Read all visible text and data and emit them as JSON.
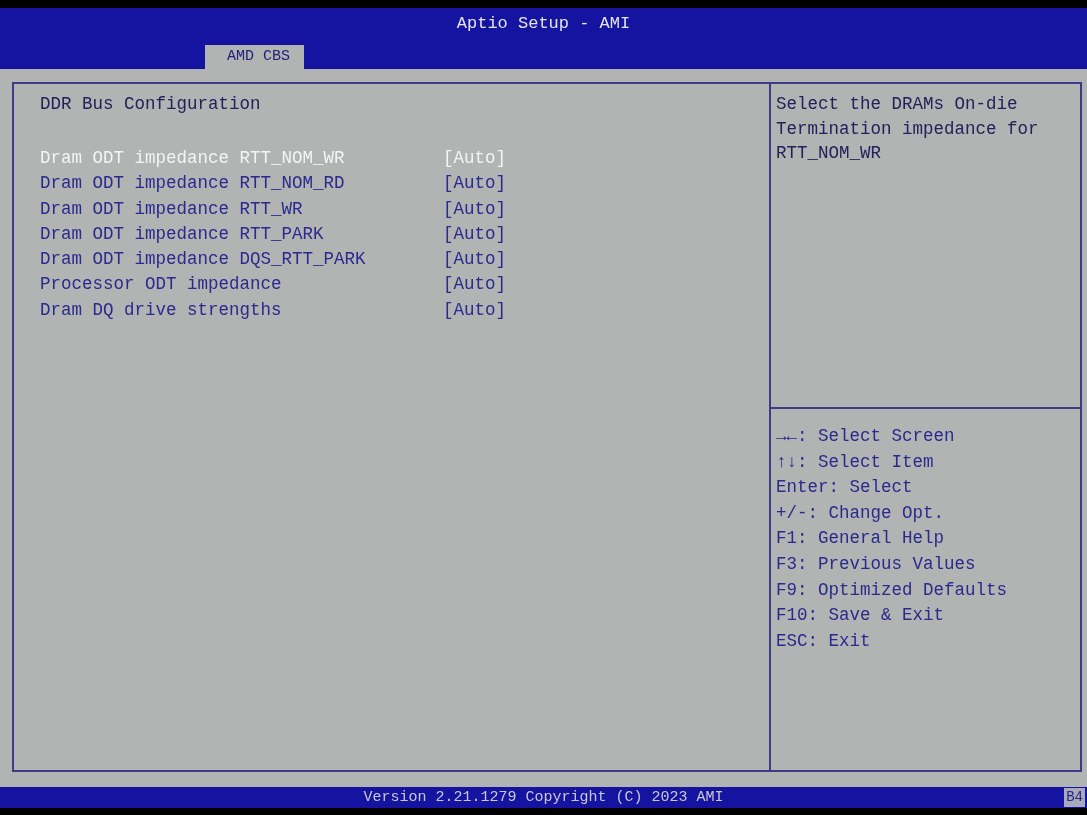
{
  "window": {
    "title": "Aptio Setup - AMI"
  },
  "tabs": [
    {
      "label": "AMD CBS",
      "selected": true
    }
  ],
  "main": {
    "heading": "DDR Bus Configuration",
    "items": [
      {
        "label": "Dram ODT impedance RTT_NOM_WR",
        "value": "[Auto]",
        "selected": true
      },
      {
        "label": "Dram ODT impedance RTT_NOM_RD",
        "value": "[Auto]",
        "selected": false
      },
      {
        "label": "Dram ODT impedance RTT_WR",
        "value": "[Auto]",
        "selected": false
      },
      {
        "label": "Dram ODT impedance RTT_PARK",
        "value": "[Auto]",
        "selected": false
      },
      {
        "label": "Dram ODT impedance DQS_RTT_PARK",
        "value": "[Auto]",
        "selected": false
      },
      {
        "label": "Processor ODT impedance",
        "value": "[Auto]",
        "selected": false
      },
      {
        "label": "Dram DQ drive strengths",
        "value": "[Auto]",
        "selected": false
      }
    ]
  },
  "help": {
    "description": "Select the DRAMs On-die Termination impedance for RTT_NOM_WR",
    "keys": [
      "→←: Select Screen",
      "↑↓: Select Item",
      "Enter: Select",
      "+/-: Change Opt.",
      "F1: General Help",
      "F3: Previous Values",
      "F9: Optimized Defaults",
      "F10: Save & Exit",
      "ESC: Exit"
    ]
  },
  "status_bar": {
    "version": "Version 2.21.1279 Copyright (C) 2023 AMI",
    "post_code": "B4"
  }
}
